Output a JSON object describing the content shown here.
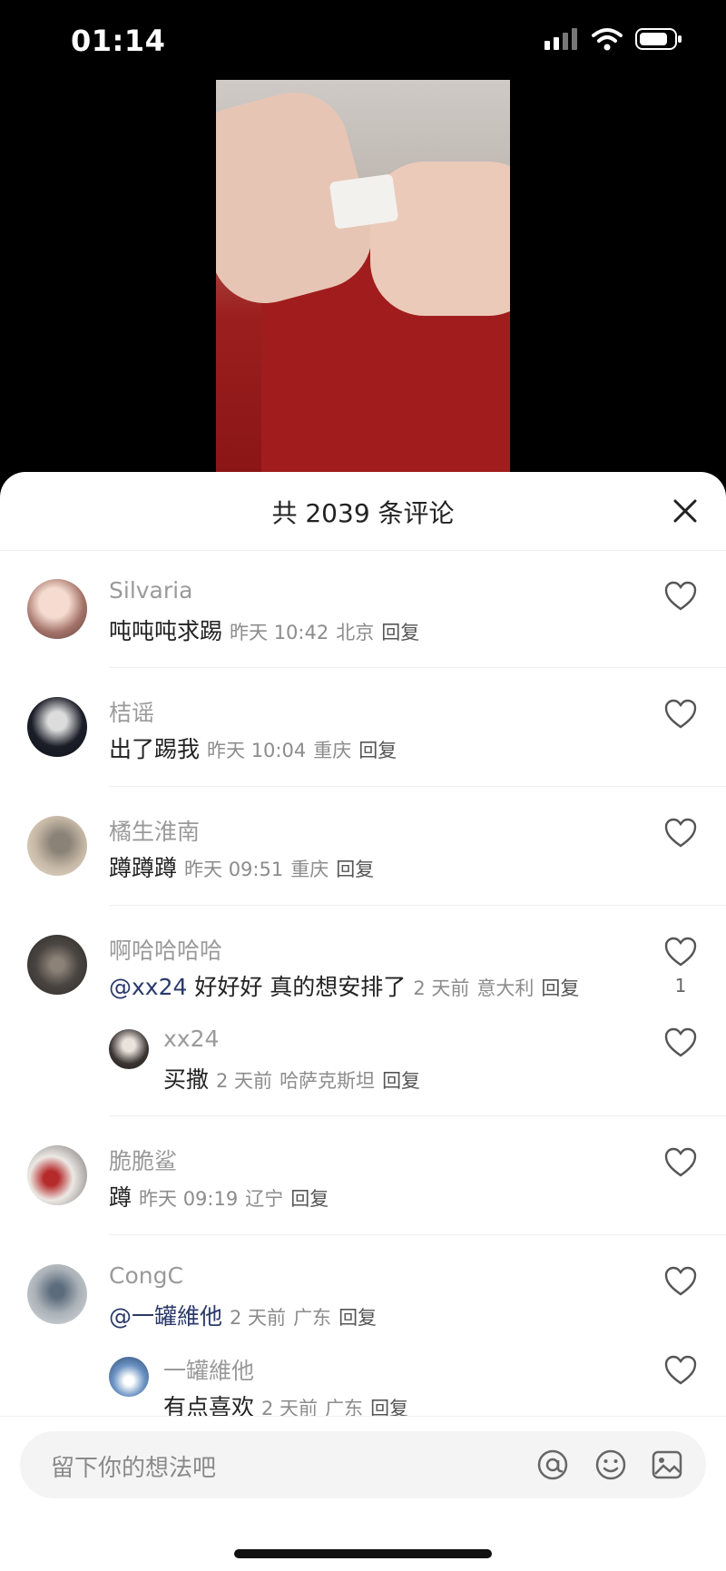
{
  "status": {
    "time": "01:14"
  },
  "sheet": {
    "title": "共 2039 条评论"
  },
  "comments": [
    {
      "name": "Silvaria",
      "text": "吨吨吨求踢",
      "time": "昨天 10:42",
      "location": "北京",
      "reply": "回复"
    },
    {
      "name": "桔谣",
      "text": "出了踢我",
      "time": "昨天 10:04",
      "location": "重庆",
      "reply": "回复"
    },
    {
      "name": "橘生淮南",
      "text": "蹲蹲蹲",
      "time": "昨天 09:51",
      "location": "重庆",
      "reply": "回复"
    },
    {
      "name": "啊哈哈哈哈",
      "mention": "@xx24",
      "text": " 好好好 真的想安排了",
      "time": "2 天前",
      "location": "意大利",
      "reply": "回复",
      "likes": "1"
    },
    {
      "name": "xx24",
      "text": "买撒",
      "time": "2 天前",
      "location": "哈萨克斯坦",
      "reply": "回复"
    },
    {
      "name": "脆脆鲨",
      "text": "蹲",
      "time": "昨天 09:19",
      "location": "辽宁",
      "reply": "回复"
    },
    {
      "name": "CongC",
      "mention": "@一罐維他",
      "text": "",
      "time": "2 天前",
      "location": "广东",
      "reply": "回复"
    },
    {
      "name": "一罐維他",
      "text": "有点喜欢",
      "time": "2 天前",
      "location": "广东",
      "reply": "回复"
    }
  ],
  "input": {
    "placeholder": "留下你的想法吧"
  },
  "icons": {
    "mention": "at-icon",
    "emoji": "emoji-icon",
    "image": "image-icon",
    "like": "heart-icon",
    "close": "close-icon"
  }
}
